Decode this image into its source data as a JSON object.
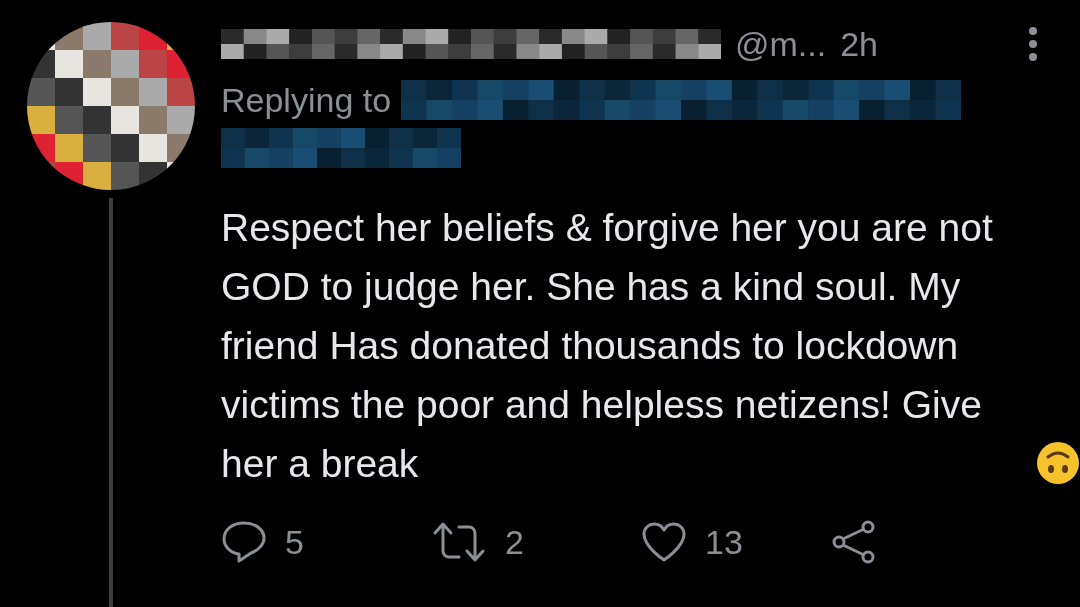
{
  "tweet": {
    "handle": "@m...",
    "time": "2h",
    "replying_to": "Replying to",
    "text": "Respect her beliefs & forgive her you are not GOD to judge her. She has a kind soul. My friend Has donated thousands to lockdown victims the poor and helpless netizens! Give her a break",
    "actions": [
      {
        "kind": "reply",
        "count": "5"
      },
      {
        "kind": "retweet",
        "count": "2"
      },
      {
        "kind": "like",
        "count": "13"
      },
      {
        "kind": "share"
      }
    ]
  }
}
